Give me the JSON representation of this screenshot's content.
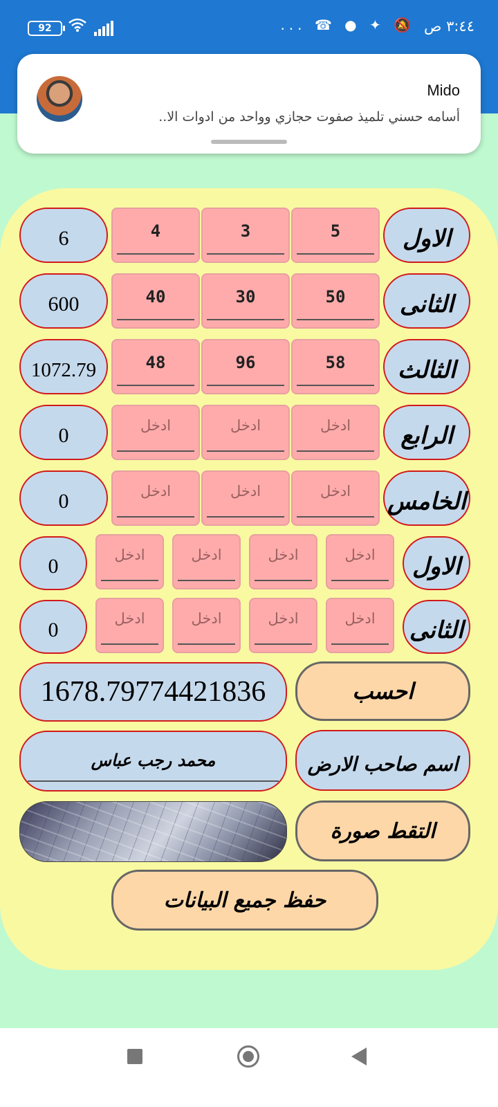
{
  "status_bar": {
    "time": "٣:٤٤ ص",
    "battery": "92",
    "icons": [
      "wifi-icon",
      "signal-icon",
      "dots-icon",
      "missed-call-icon",
      "chat-icon",
      "twitter-icon",
      "mute-icon"
    ],
    "more": "..."
  },
  "notification": {
    "title": "Mido",
    "body": "أسامه حسني تلميذ صفوت حجازي وواحد من ادوات الا.."
  },
  "rows_three": [
    {
      "label": "الاول",
      "inputs": [
        "4",
        "3",
        "5"
      ],
      "result": "6"
    },
    {
      "label": "الثانى",
      "inputs": [
        "40",
        "30",
        "50"
      ],
      "result": "600"
    },
    {
      "label": "الثالث",
      "inputs": [
        "48",
        "96",
        "58"
      ],
      "result": "1072.79"
    },
    {
      "label": "الرابع",
      "inputs": [
        "",
        "",
        ""
      ],
      "result": "0"
    },
    {
      "label": "الخامس",
      "inputs": [
        "",
        "",
        ""
      ],
      "result": "0"
    }
  ],
  "rows_four": [
    {
      "label": "الاول",
      "inputs": [
        "",
        "",
        "",
        ""
      ],
      "result": "0"
    },
    {
      "label": "الثانى",
      "inputs": [
        "",
        "",
        "",
        ""
      ],
      "result": "0"
    }
  ],
  "placeholder": "ادخل",
  "calculate_label": "احسب",
  "total": "1678.79774421836",
  "owner_label": "اسم صاحب الارض",
  "owner_name": "محمد رجب عباس",
  "capture_label": "التقط صورة",
  "save_label": "حفظ جميع البيانات",
  "colors": {
    "status_bar": "#1f78d1",
    "background": "#bff9d0",
    "panel": "#f9f9a2",
    "input_fill": "#ffabab",
    "pill_fill": "#c5d9ec",
    "pill_border": "#d11a1a",
    "button_fill": "#fdd7a8"
  }
}
